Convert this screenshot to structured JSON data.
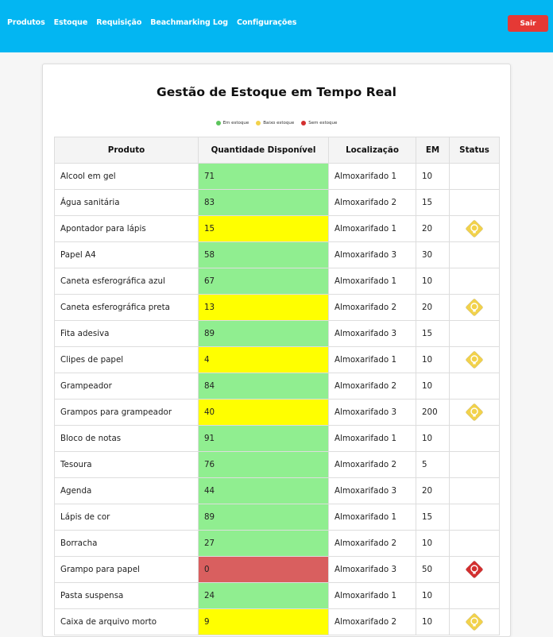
{
  "nav": {
    "items": [
      "Produtos",
      "Estoque",
      "Requisição",
      "Beachmarking Log",
      "Configurações"
    ],
    "logout_label": "Sair"
  },
  "page": {
    "title": "Gestão de Estoque em Tempo Real"
  },
  "legend": [
    {
      "label": "Em estoque",
      "color": "#5cc45c"
    },
    {
      "label": "Baixo estoque",
      "color": "#f2d24b"
    },
    {
      "label": "Sem estoque",
      "color": "#d32f2f"
    }
  ],
  "table": {
    "headers": [
      "Produto",
      "Quantidade Disponível",
      "Localização",
      "EM",
      "Status"
    ],
    "rows": [
      {
        "produto": "Alcool em gel",
        "quantidade": "71",
        "localizacao": "Almoxarifado 1",
        "em": "10",
        "level": "green",
        "status": ""
      },
      {
        "produto": "Água sanitária",
        "quantidade": "83",
        "localizacao": "Almoxarifado 2",
        "em": "15",
        "level": "green",
        "status": ""
      },
      {
        "produto": "Apontador para lápis",
        "quantidade": "15",
        "localizacao": "Almoxarifado 1",
        "em": "20",
        "level": "yellow",
        "status": "warning-icon"
      },
      {
        "produto": "Papel A4",
        "quantidade": "58",
        "localizacao": "Almoxarifado 3",
        "em": "30",
        "level": "green",
        "status": ""
      },
      {
        "produto": "Caneta esferográfica azul",
        "quantidade": "67",
        "localizacao": "Almoxarifado 1",
        "em": "10",
        "level": "green",
        "status": ""
      },
      {
        "produto": "Caneta esferográfica preta",
        "quantidade": "13",
        "localizacao": "Almoxarifado 2",
        "em": "20",
        "level": "yellow",
        "status": "warning-icon"
      },
      {
        "produto": "Fita adesiva",
        "quantidade": "89",
        "localizacao": "Almoxarifado 3",
        "em": "15",
        "level": "green",
        "status": ""
      },
      {
        "produto": "Clipes de papel",
        "quantidade": "4",
        "localizacao": "Almoxarifado 1",
        "em": "10",
        "level": "yellow",
        "status": "warning-icon"
      },
      {
        "produto": "Grampeador",
        "quantidade": "84",
        "localizacao": "Almoxarifado 2",
        "em": "10",
        "level": "green",
        "status": ""
      },
      {
        "produto": "Grampos para grampeador",
        "quantidade": "40",
        "localizacao": "Almoxarifado 3",
        "em": "200",
        "level": "yellow",
        "status": "warning-icon"
      },
      {
        "produto": "Bloco de notas",
        "quantidade": "91",
        "localizacao": "Almoxarifado 1",
        "em": "10",
        "level": "green",
        "status": ""
      },
      {
        "produto": "Tesoura",
        "quantidade": "76",
        "localizacao": "Almoxarifado 2",
        "em": "5",
        "level": "green",
        "status": ""
      },
      {
        "produto": "Agenda",
        "quantidade": "44",
        "localizacao": "Almoxarifado 3",
        "em": "20",
        "level": "green",
        "status": ""
      },
      {
        "produto": "Lápis de cor",
        "quantidade": "89",
        "localizacao": "Almoxarifado 1",
        "em": "15",
        "level": "green",
        "status": ""
      },
      {
        "produto": "Borracha",
        "quantidade": "27",
        "localizacao": "Almoxarifado 2",
        "em": "10",
        "level": "green",
        "status": ""
      },
      {
        "produto": "Grampo para papel",
        "quantidade": "0",
        "localizacao": "Almoxarifado 3",
        "em": "50",
        "level": "red",
        "status": "critical-icon"
      },
      {
        "produto": "Pasta suspensa",
        "quantidade": "24",
        "localizacao": "Almoxarifado 1",
        "em": "10",
        "level": "green",
        "status": ""
      },
      {
        "produto": "Caixa de arquivo morto",
        "quantidade": "9",
        "localizacao": "Almoxarifado 2",
        "em": "10",
        "level": "yellow",
        "status": "warning-icon"
      }
    ]
  },
  "colors": {
    "topbar": "#03b6f2",
    "logout": "#e53935",
    "qty_green": "#90ee90",
    "qty_yellow": "#ffff00",
    "qty_red": "#d95f5f",
    "warning_icon": "#f2d24b",
    "critical_icon": "#d32f2f"
  }
}
